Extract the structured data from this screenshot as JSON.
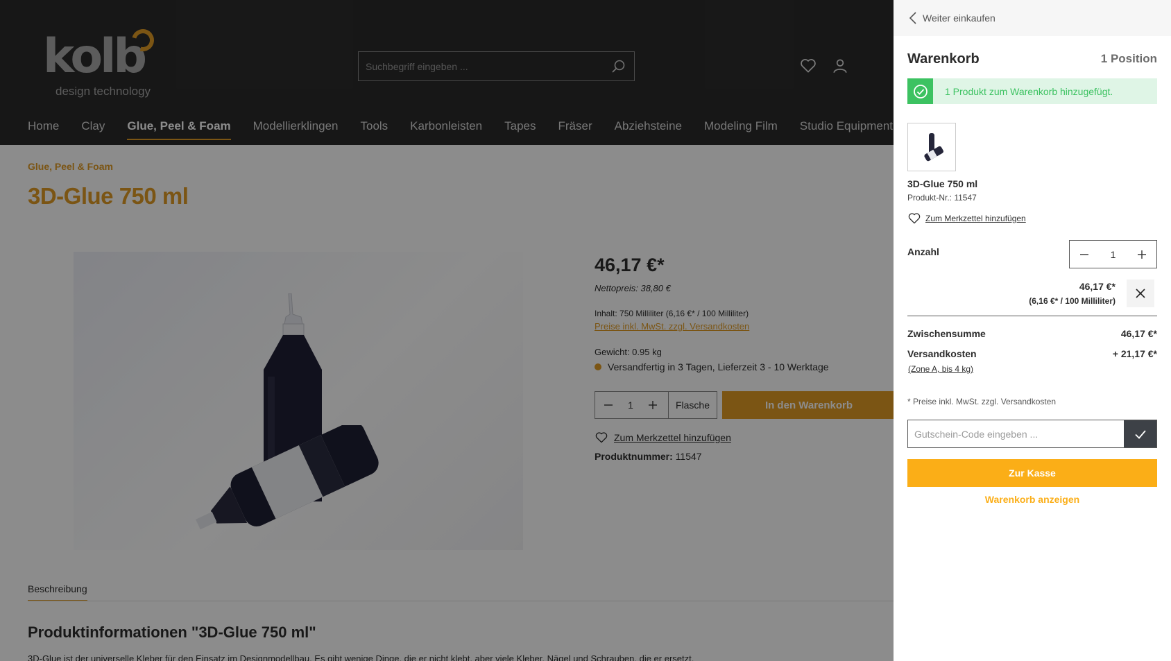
{
  "header": {
    "logo_word": "kolb",
    "logo_tagline": "design technology",
    "search_placeholder": "Suchbegriff eingeben ..."
  },
  "nav": {
    "items": [
      {
        "label": "Home",
        "active": false
      },
      {
        "label": "Clay",
        "active": false
      },
      {
        "label": "Glue, Peel & Foam",
        "active": true
      },
      {
        "label": "Modellierklingen",
        "active": false
      },
      {
        "label": "Tools",
        "active": false
      },
      {
        "label": "Karbonleisten",
        "active": false
      },
      {
        "label": "Tapes",
        "active": false
      },
      {
        "label": "Fräser",
        "active": false
      },
      {
        "label": "Abziehsteine",
        "active": false
      },
      {
        "label": "Modeling Film",
        "active": false
      },
      {
        "label": "Studio Equipment",
        "active": false
      }
    ]
  },
  "product": {
    "breadcrumb": "Glue, Peel & Foam",
    "title": "3D-Glue 750 ml",
    "price": "46,17 €*",
    "netto": "Nettopreis: 38,80 €",
    "inhalt": "Inhalt: 750 Milliliter (6,16 €* / 100 Milliliter)",
    "vat_link": "Preise inkl. MwSt. zzgl. Versandkosten",
    "weight": "Gewicht: 0.95 kg",
    "delivery": "Versandfertig in 3 Tagen, Lieferzeit 3 - 10 Werktage",
    "qty": "1",
    "unit": "Flasche",
    "add_to_cart": "In den Warenkorb",
    "wishlist": "Zum Merkzettel hinzufügen",
    "number_label": "Produktnummer:",
    "number": "11547",
    "tab": "Beschreibung",
    "info_heading": "Produktinformationen \"3D-Glue 750 ml\"",
    "info_text": "3D-Glue ist der universelle Kleber für den Einsatz im Designmodellbau. Es gibt wenige Dinge, die er nicht klebt, aber viele Kleber, Nägel und Schrauben, die er ersetzt."
  },
  "cart": {
    "back": "Weiter einkaufen",
    "title": "Warenkorb",
    "positions": "1 Position",
    "alert": "1 Produkt zum Warenkorb hinzugefügt.",
    "item": {
      "name": "3D-Glue 750 ml",
      "number": "Produkt-Nr.: 11547",
      "wishlist": "Zum Merkzettel hinzufügen",
      "qty_label": "Anzahl",
      "qty": "1",
      "price": "46,17 €*",
      "unit_price": "(6,16 €* / 100 Milliliter)"
    },
    "subtotal_label": "Zwischensumme",
    "subtotal": "46,17 €*",
    "shipping_label": "Versandkosten",
    "shipping": "+ 21,17 €*",
    "zone": "(Zone A, bis 4 kg)",
    "note": "* Preise inkl. MwSt. zzgl. Versandkosten",
    "voucher_placeholder": "Gutschein-Code eingeben ...",
    "checkout": "Zur Kasse",
    "show_cart": "Warenkorb anzeigen"
  },
  "colors": {
    "brand_orange": "#e09b25",
    "checkout_yellow": "#fbae17",
    "header_dark": "#2b2b2b",
    "success_green": "#3cc261"
  }
}
